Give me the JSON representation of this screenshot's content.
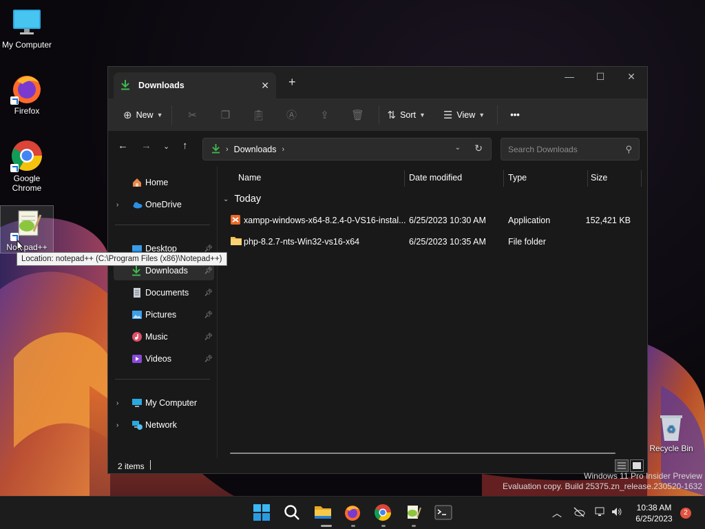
{
  "desktop": {
    "icons": [
      {
        "label": "My Computer",
        "icon": "monitor-icon"
      },
      {
        "label": "Firefox",
        "icon": "firefox-icon"
      },
      {
        "label": "Google Chrome",
        "icon": "chrome-icon"
      },
      {
        "label": "Notepad++",
        "icon": "notepad-plus-plus-icon"
      },
      {
        "label": "Recycle Bin",
        "icon": "recycle-bin-icon"
      }
    ],
    "tooltip": "Location: notepad++ (C:\\Program Files (x86)\\Notepad++)"
  },
  "window": {
    "tab_title": "Downloads",
    "toolbar": {
      "new_label": "New",
      "sort_label": "Sort",
      "view_label": "View",
      "more_label": "•••"
    },
    "address": {
      "crumb": "Downloads",
      "search_placeholder": "Search Downloads"
    },
    "nav": {
      "home": "Home",
      "onedrive": "OneDrive",
      "quick": [
        "Desktop",
        "Downloads",
        "Documents",
        "Pictures",
        "Music",
        "Videos"
      ],
      "my_computer": "My Computer",
      "network": "Network"
    },
    "columns": {
      "name": "Name",
      "date": "Date modified",
      "type": "Type",
      "size": "Size"
    },
    "group": "Today",
    "files": [
      {
        "name": "xampp-windows-x64-8.2.4-0-VS16-instal...",
        "date": "6/25/2023 10:30 AM",
        "type": "Application",
        "size": "152,421 KB"
      },
      {
        "name": "php-8.2.7-nts-Win32-vs16-x64",
        "date": "6/25/2023 10:35 AM",
        "type": "File folder",
        "size": ""
      }
    ],
    "status": "2 items"
  },
  "watermark": {
    "line1": "Windows 11 Pro Insider Preview",
    "line2": "Evaluation copy. Build 25375.zn_release.230520-1632"
  },
  "taskbar": {
    "time": "10:38 AM",
    "date": "6/25/2023",
    "notifications": "2"
  },
  "colors": {
    "accent_green": "#3fb950",
    "folder_yellow": "#f3c14b",
    "window_bg": "#191919",
    "toolbar_bg": "#2b2b2b"
  }
}
